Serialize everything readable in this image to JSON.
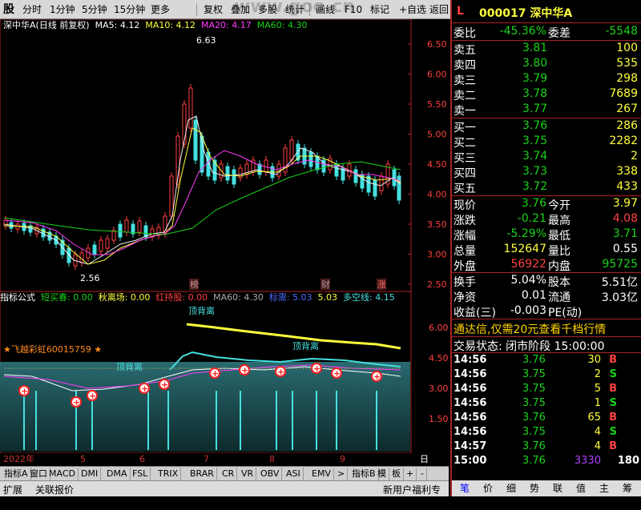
{
  "toolbar": {
    "items": [
      "分时",
      "1分钟",
      "5分钟",
      "15分钟",
      "更多",
      "复权",
      "叠加",
      "多股",
      "统计",
      "画线",
      "F10",
      "标记",
      "+自选",
      "返回"
    ],
    "watermark": "www.goo.cn",
    "top_left_label": "股"
  },
  "main_chart": {
    "title": "深中华A(日线 前复权)",
    "ma5_label": "MA5: 4.12",
    "ma10_label": "MA10: 4.12",
    "ma20_label": "MA20: 4.17",
    "ma60_label": "MA60: 4.30",
    "high_label": "6.63",
    "low_label": "2.56",
    "markers": [
      "榜",
      "财",
      "涨"
    ],
    "y_ticks": [
      "6.50",
      "6.00",
      "5.50",
      "5.00",
      "4.50",
      "4.00",
      "3.50",
      "3.00",
      "2.50"
    ]
  },
  "indicator": {
    "label": "指标公式",
    "items": [
      "短买春: 0.00",
      "秋离场: 0.00",
      "红持股: 0.00",
      "MA60: 4.30",
      "标需: 5.03",
      "5.03",
      "多空线: 4.15"
    ],
    "flag_text": "★飞越彩虹60015759 ★",
    "annotations": [
      "顶背离",
      "顶背离",
      "顶背离"
    ],
    "y_ticks": [
      "6.00",
      "4.50",
      "3.00",
      "1.50"
    ]
  },
  "time_axis": [
    "2022年",
    "5",
    "6",
    "7",
    "8",
    "9"
  ],
  "period_label": "日线",
  "bottom_tabs": [
    "指标A",
    "窗口",
    "MACD",
    "DMI",
    "DMA",
    "FSL",
    "TRIX",
    "BRAR",
    "CR",
    "VR",
    "OBV",
    "ASI",
    "EMV",
    ">",
    "指标B",
    "模",
    "板",
    "+",
    "-"
  ],
  "status_left": [
    "扩展",
    "关联报价"
  ],
  "status_right": "新用户福利专享",
  "quote": {
    "market_flag": "L",
    "code_name": "000017 深中华A",
    "webi_label": "委比",
    "webi": "-45.36%",
    "weicha_label": "委差",
    "weicha": "-5548",
    "sells": [
      {
        "label": "卖五",
        "price": "3.81",
        "vol": "100"
      },
      {
        "label": "卖四",
        "price": "3.80",
        "vol": "535"
      },
      {
        "label": "卖三",
        "price": "3.79",
        "vol": "298"
      },
      {
        "label": "卖二",
        "price": "3.78",
        "vol": "7689"
      },
      {
        "label": "卖一",
        "price": "3.77",
        "vol": "267"
      }
    ],
    "buys": [
      {
        "label": "买一",
        "price": "3.76",
        "vol": "286"
      },
      {
        "label": "买二",
        "price": "3.75",
        "vol": "2282"
      },
      {
        "label": "买三",
        "price": "3.74",
        "vol": "2"
      },
      {
        "label": "买四",
        "price": "3.73",
        "vol": "338"
      },
      {
        "label": "买五",
        "price": "3.72",
        "vol": "433"
      }
    ],
    "stats": [
      {
        "l1": "现价",
        "v1": "3.76",
        "l2": "今开",
        "v2": "3.97"
      },
      {
        "l1": "涨跌",
        "v1": "-0.21",
        "l2": "最高",
        "v2": "4.08"
      },
      {
        "l1": "涨幅",
        "v1": "-5.29%",
        "l2": "最低",
        "v2": "3.71"
      },
      {
        "l1": "总量",
        "v1": "152647",
        "l2": "量比",
        "v2": "0.55"
      },
      {
        "l1": "外盘",
        "v1": "56922",
        "l2": "内盘",
        "v2": "95725"
      }
    ],
    "fin": [
      {
        "l1": "换手",
        "v1": "5.04%",
        "l2": "股本",
        "v2": "5.51亿"
      },
      {
        "l1": "净资",
        "v1": "0.01",
        "l2": "流通",
        "v2": "3.03亿"
      },
      {
        "l1": "收益(三)",
        "v1": "-0.003",
        "l2": "PE(动)",
        "v2": ""
      }
    ],
    "promo": "通达信,仅需20元查看千档行情",
    "trade_status": "交易状态: 闭市阶段 15:00:00",
    "ticks": [
      {
        "t": "14:56",
        "p": "3.76",
        "v": "30",
        "s": "B"
      },
      {
        "t": "14:56",
        "p": "3.75",
        "v": "2",
        "s": "S"
      },
      {
        "t": "14:56",
        "p": "3.75",
        "v": "5",
        "s": "B"
      },
      {
        "t": "14:56",
        "p": "3.75",
        "v": "1",
        "s": "S"
      },
      {
        "t": "14:56",
        "p": "3.76",
        "v": "65",
        "s": "B"
      },
      {
        "t": "14:56",
        "p": "3.75",
        "v": "4",
        "s": "S"
      },
      {
        "t": "14:57",
        "p": "3.76",
        "v": "4",
        "s": "B"
      },
      {
        "t": "15:00",
        "p": "3.76",
        "v": "3330",
        "s": "180"
      }
    ],
    "footer_tabs": [
      "笔",
      "价",
      "细",
      "势",
      "联",
      "值",
      "主",
      "筹"
    ]
  },
  "colors": {
    "up": "#ff4040",
    "down": "#19d319",
    "panel_border": "#a22222"
  }
}
